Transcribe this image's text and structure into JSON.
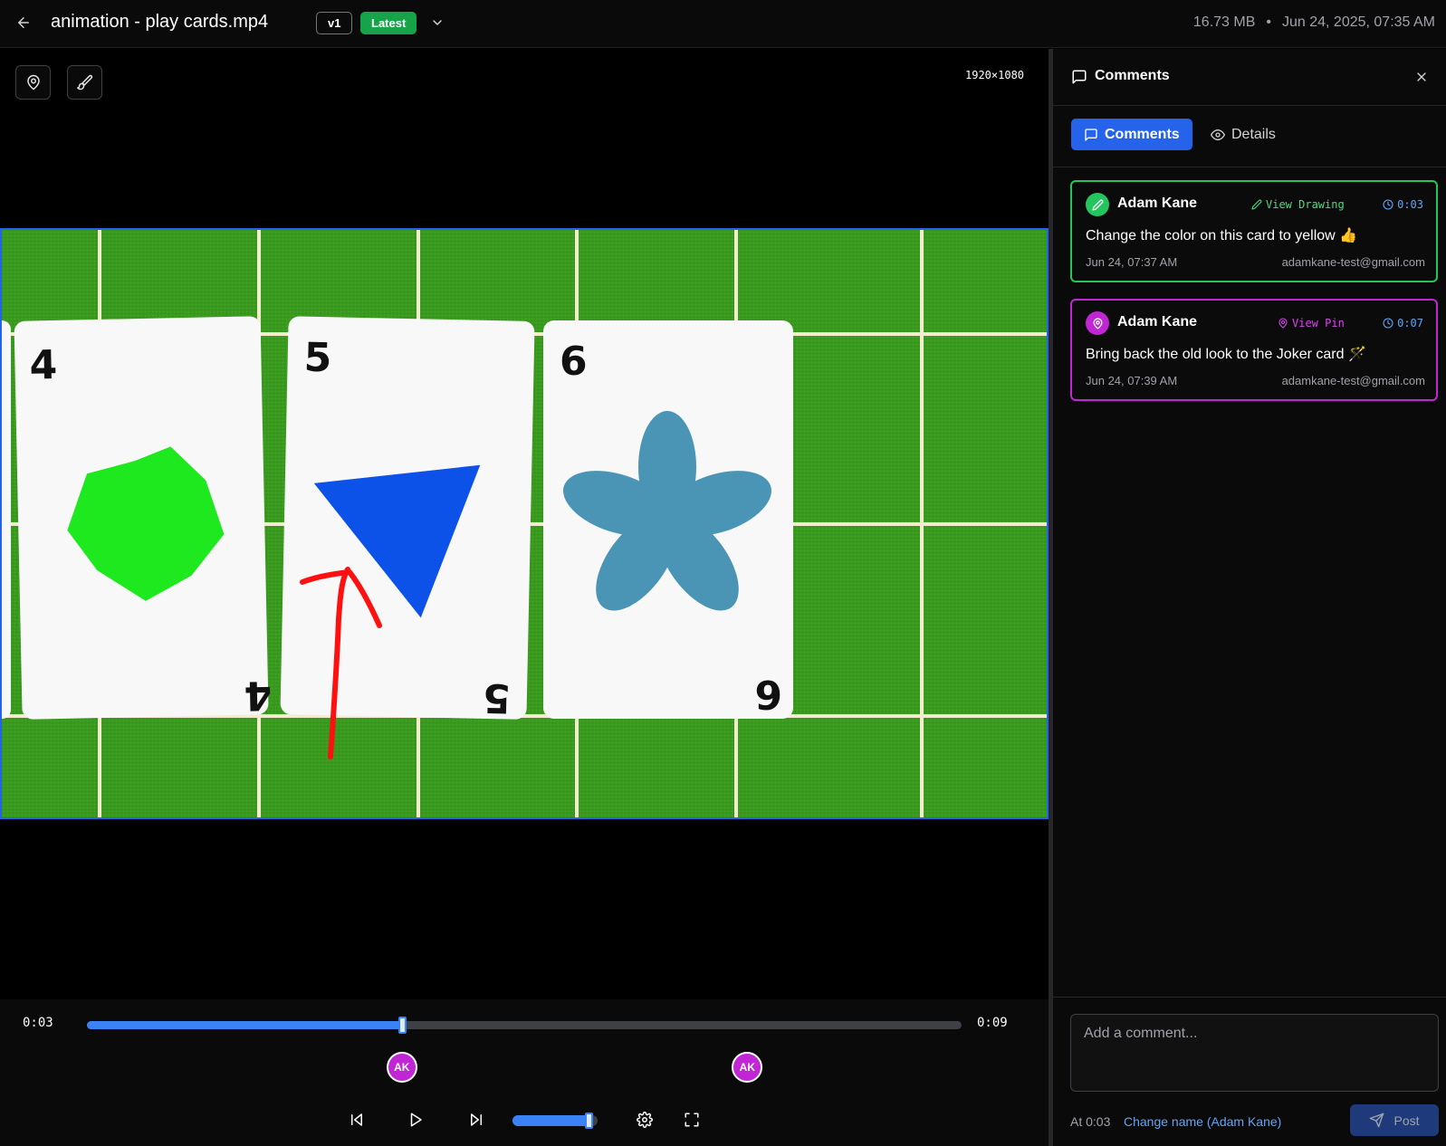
{
  "header": {
    "title": "animation - play cards.mp4",
    "version": "v1",
    "latest_label": "Latest",
    "file_size": "16.73 MB",
    "separator": "•",
    "upload_date": "Jun 24, 2025, 07:35 AM"
  },
  "video": {
    "resolution": "1920×1080",
    "cards": [
      {
        "top_label": "4",
        "bottom_label": "4",
        "shape": "heptagon-star",
        "color": "#1ee81e"
      },
      {
        "top_label": "5",
        "bottom_label": "5",
        "shape": "triangle",
        "color": "#0d52e8"
      },
      {
        "top_label": "6",
        "bottom_label": "6",
        "shape": "flower",
        "color": "#4a95b5"
      }
    ],
    "colors": {
      "table": "#3a9a1f",
      "grid": "#f3eccf",
      "drawing": "#ff1010",
      "frame_border": "#2563eb"
    }
  },
  "player": {
    "current_time": "0:03",
    "total_time": "0:09",
    "progress": 0.36,
    "volume": 0.92,
    "markers": [
      {
        "initials": "AK",
        "position": 0.36
      },
      {
        "initials": "AK",
        "position": 0.755
      }
    ]
  },
  "panel": {
    "title": "Comments",
    "tabs": [
      {
        "label": "Comments",
        "active": true
      },
      {
        "label": "Details",
        "active": false
      }
    ],
    "comments": [
      {
        "author": "Adam Kane",
        "action": "View Drawing",
        "action_type": "drawing",
        "timestamp": "0:03",
        "text": "Change the color on this card to yellow 👍",
        "date": "Jun 24, 07:37 AM",
        "email": "adamkane-test@gmail.com",
        "accent": "#22c55e"
      },
      {
        "author": "Adam Kane",
        "action": "View Pin",
        "action_type": "pin",
        "timestamp": "0:07",
        "text": "Bring back the old look to the Joker card 🪄",
        "date": "Jun 24, 07:39 AM",
        "email": "adamkane-test@gmail.com",
        "accent": "#c026d3"
      }
    ],
    "composer": {
      "placeholder": "Add a comment...",
      "at_time": "At 0:03",
      "change_name": "Change name (Adam Kane)",
      "post_label": "Post"
    }
  }
}
